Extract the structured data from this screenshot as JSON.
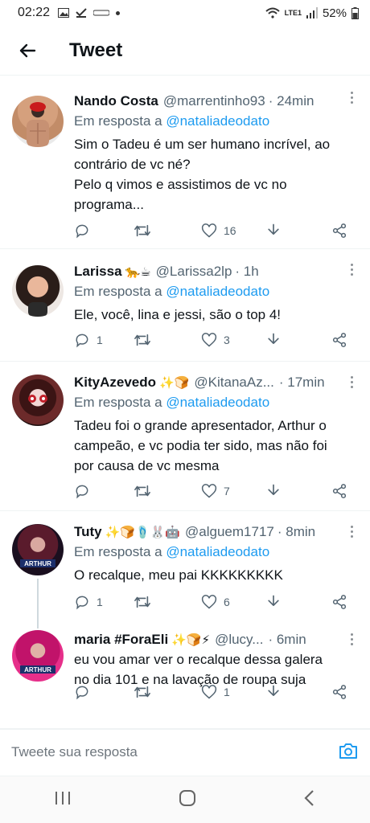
{
  "status_bar": {
    "time": "02:22",
    "battery": "52%",
    "network": "LTE1"
  },
  "header": {
    "title": "Tweet"
  },
  "tweets": [
    {
      "name": "Nando Costa",
      "emojis": "",
      "handle": "@marrentinho93",
      "time": "· 24min",
      "reply_prefix": "Em resposta a",
      "reply_to": "@nataliadeodato",
      "text": "Sim o Tadeu é um ser humano incrível, ao contrário de vc né?\nPelo q vimos e assistimos de vc no programa...",
      "replies": "",
      "likes": "16"
    },
    {
      "name": "Larissa",
      "emojis": "🐆☕",
      "handle": "@Larissa2lp",
      "time": "· 1h",
      "reply_prefix": "Em resposta a",
      "reply_to": "@nataliadeodato",
      "text": "Ele, você, lina e jessi, são o top 4!",
      "replies": "1",
      "likes": "3"
    },
    {
      "name": "KityAzevedo",
      "emojis": "✨🍞",
      "handle": "@KitanaAz...",
      "time": "· 17min",
      "reply_prefix": "Em resposta a",
      "reply_to": "@nataliadeodato",
      "text": "Tadeu foi o grande apresentador, Arthur o campeão, e vc podia ter sido, mas não foi por causa de vc mesma",
      "replies": "",
      "likes": "7"
    },
    {
      "name": "Tuty",
      "emojis": "✨🍞🩴🐰🤖",
      "handle": "@alguem1717",
      "time": "· 8min",
      "reply_prefix": "Em resposta a",
      "reply_to": "@nataliadeodato",
      "text": "O recalque, meu pai KKKKKKKKK",
      "replies": "1",
      "likes": "6"
    },
    {
      "name": "maria #ForaEli",
      "emojis": "✨🍞⚡",
      "handle": "@lucy...",
      "time": "· 6min",
      "reply_prefix": "",
      "reply_to": "",
      "text": "eu vou amar ver o recalque dessa galera no dia 101 e na lavação de roupa suja",
      "replies": "",
      "likes": "1"
    }
  ],
  "composer": {
    "placeholder": "Tweete sua resposta"
  },
  "colors": {
    "accent": "#1d9bf0",
    "muted": "#536471",
    "divider": "#eff3f4"
  }
}
